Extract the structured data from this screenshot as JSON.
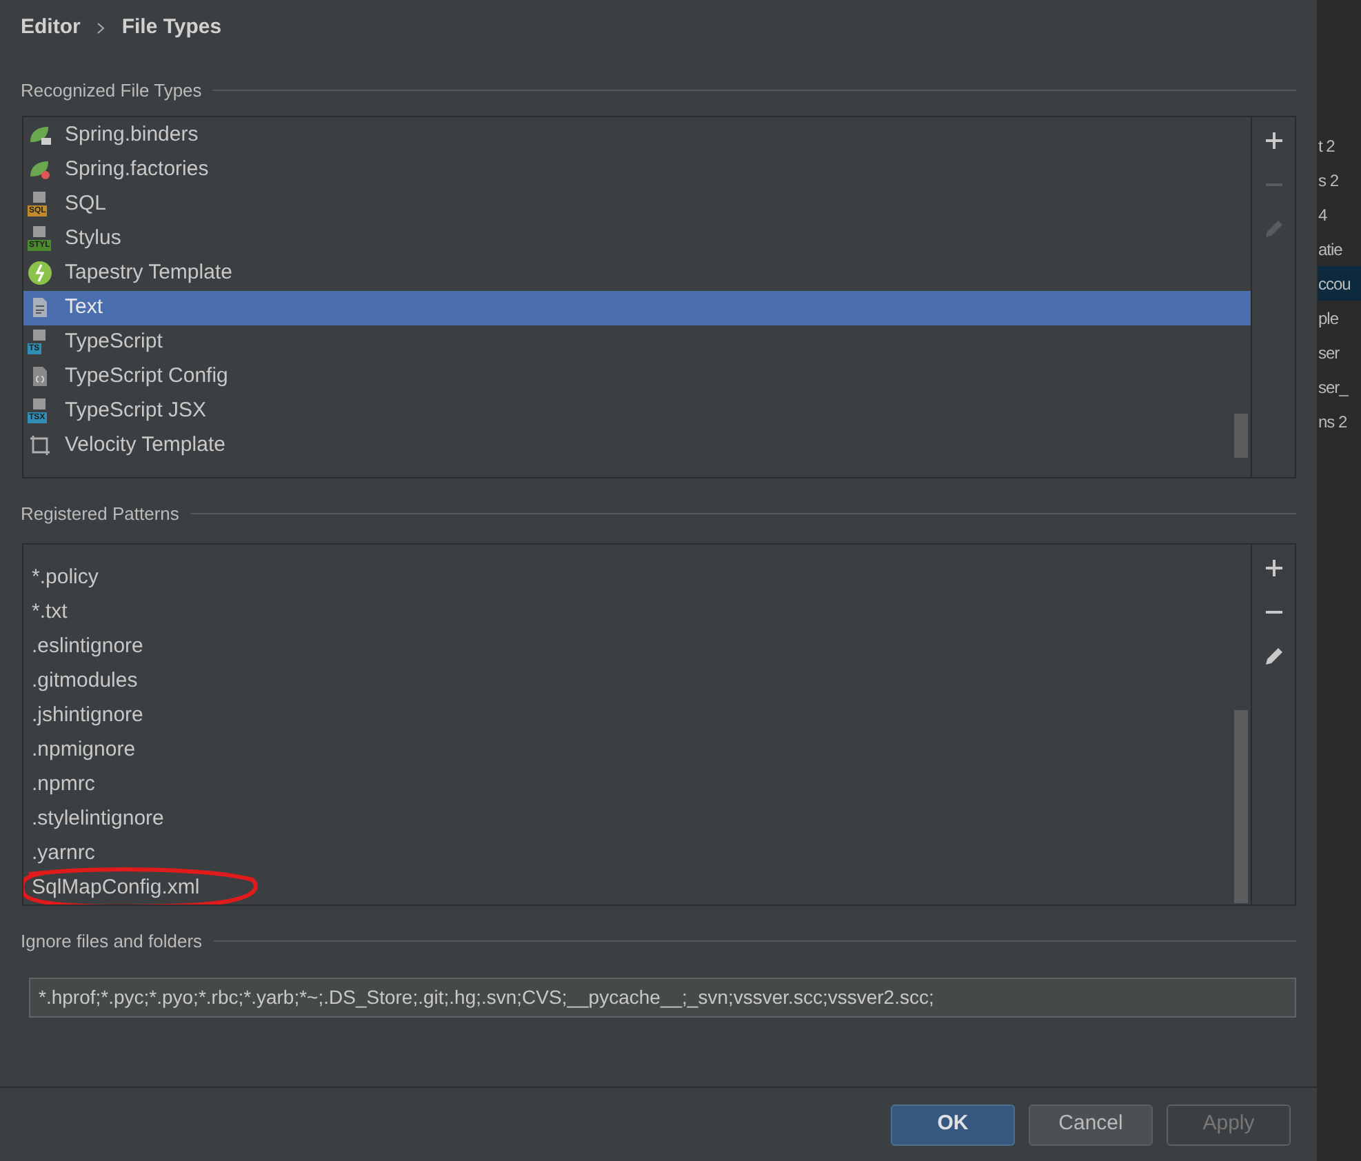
{
  "breadcrumb": [
    "Editor",
    "File Types"
  ],
  "recognized": {
    "title": "Recognized File Types",
    "items": [
      {
        "label": "Spring.binders",
        "kind": "spring-binders",
        "selected": false
      },
      {
        "label": "Spring.factories",
        "kind": "spring-factories",
        "selected": false
      },
      {
        "label": "SQL",
        "kind": "badge",
        "badge": "SQL",
        "color": "#c28a2a",
        "selected": false
      },
      {
        "label": "Stylus",
        "kind": "badge",
        "badge": "STYL",
        "color": "#4c8a2e",
        "selected": false
      },
      {
        "label": "Tapestry Template",
        "kind": "tapestry",
        "selected": false
      },
      {
        "label": "Text",
        "kind": "text",
        "selected": true
      },
      {
        "label": "TypeScript",
        "kind": "badge",
        "badge": "TS",
        "color": "#2f8fb5",
        "selected": false
      },
      {
        "label": "TypeScript Config",
        "kind": "config",
        "selected": false
      },
      {
        "label": "TypeScript JSX",
        "kind": "badge",
        "badge": "TSX",
        "color": "#2f8fb5",
        "selected": false
      },
      {
        "label": "Velocity Template",
        "kind": "velocity",
        "selected": false
      }
    ],
    "toolbar": [
      {
        "kind": "add",
        "disabled": false
      },
      {
        "kind": "remove",
        "disabled": true
      },
      {
        "kind": "edit",
        "disabled": true
      }
    ]
  },
  "patterns": {
    "title": "Registered Patterns",
    "items": [
      {
        "label": "*.policy",
        "circled": false
      },
      {
        "label": "*.txt",
        "circled": false
      },
      {
        "label": ".eslintignore",
        "circled": false
      },
      {
        "label": ".gitmodules",
        "circled": false
      },
      {
        "label": ".jshintignore",
        "circled": false
      },
      {
        "label": ".npmignore",
        "circled": false
      },
      {
        "label": ".npmrc",
        "circled": false
      },
      {
        "label": ".stylelintignore",
        "circled": false
      },
      {
        "label": ".yarnrc",
        "circled": false
      },
      {
        "label": "SqlMapConfig.xml",
        "circled": true
      }
    ],
    "toolbar": [
      {
        "kind": "add",
        "disabled": false
      },
      {
        "kind": "remove",
        "disabled": false
      },
      {
        "kind": "edit",
        "disabled": false
      }
    ]
  },
  "ignore": {
    "title": "Ignore files and folders",
    "value": "*.hprof;*.pyc;*.pyo;*.rbc;*.yarb;*~;.DS_Store;.git;.hg;.svn;CVS;__pycache__;_svn;vssver.scc;vssver2.scc;"
  },
  "buttons": [
    {
      "label": "OK",
      "kind": "primary",
      "disabled": false
    },
    {
      "label": "Cancel",
      "kind": "normal",
      "disabled": false
    },
    {
      "label": "Apply",
      "kind": "normal",
      "disabled": true
    }
  ],
  "background_editor": [
    {
      "text": "t 2",
      "selected": false
    },
    {
      "text": "s 2",
      "selected": false
    },
    {
      "text": "4",
      "selected": false
    },
    {
      "text": "atie",
      "selected": false
    },
    {
      "text": "ccou",
      "selected": true
    },
    {
      "text": "ple",
      "selected": false
    },
    {
      "text": "ser",
      "selected": false
    },
    {
      "text": "ser_",
      "selected": false
    },
    {
      "text": "ns 2",
      "selected": false
    }
  ]
}
